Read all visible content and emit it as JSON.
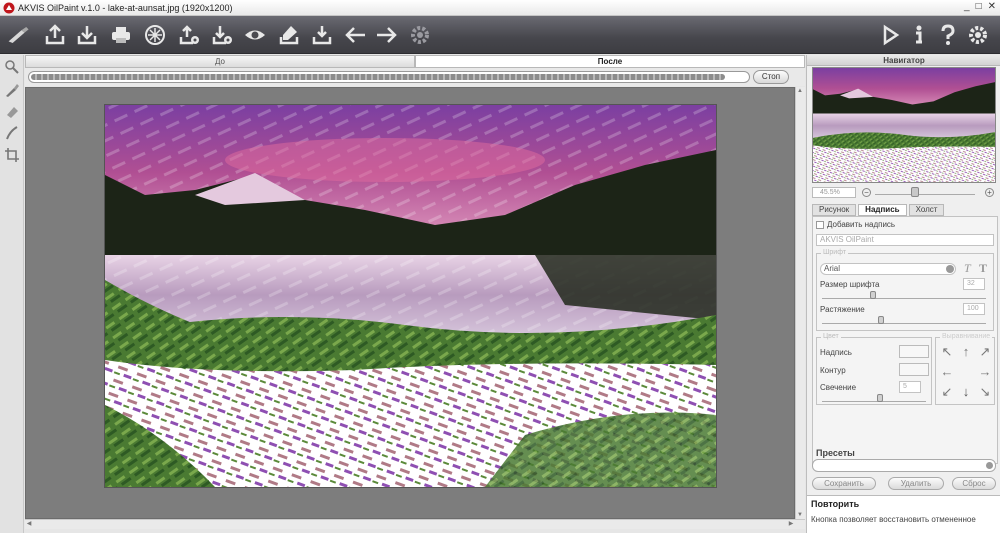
{
  "window": {
    "title": "AKVIS OilPaint v.1.0 - lake-at-aunsat.jpg (1920x1200)",
    "controls": [
      "_",
      "□",
      "✕"
    ]
  },
  "toolbar": {
    "left_icons": [
      "brush-logo-icon",
      "open-icon",
      "save-icon",
      "print-icon",
      "share-icon",
      "upload-settings-icon",
      "download-settings-icon",
      "eye-icon",
      "save-preset-icon",
      "load-preset-icon",
      "undo-icon",
      "redo-icon",
      "gear-settings-icon"
    ],
    "right_icons": [
      "run-icon",
      "info-icon",
      "help-icon",
      "preferences-icon"
    ]
  },
  "left_tools": [
    "zoom-tool-icon",
    "brush-tool-icon",
    "eraser-tool-icon",
    "smudge-tool-icon",
    "crop-tool-icon"
  ],
  "view_tabs": {
    "before": "До",
    "after": "После"
  },
  "progress": {
    "value": 0.97,
    "stop_label": "Стоп"
  },
  "navigator": {
    "title": "Навигатор",
    "zoom": "45.5%"
  },
  "panel_tabs": {
    "tab1": "Рисунок",
    "tab2": "Надпись",
    "tab3": "Холст"
  },
  "text": {
    "add_text_label": "Добавить надпись",
    "text_value": "AKVIS OilPaint",
    "font_group": "Шрифт",
    "font_name": "Arial",
    "font_size_label": "Размер шрифта",
    "font_size": "32",
    "stretch_label": "Растяжение",
    "stretch": "100",
    "color_group": "Цвет",
    "text_color_label": "Надпись",
    "outline_label": "Контур",
    "glow_label": "Свечение",
    "glow": "5",
    "alignment_group": "Выравнивание",
    "align_arrows": [
      "↖",
      "↑",
      "↗",
      "←",
      "→",
      "↙",
      "↓",
      "↘"
    ]
  },
  "presets": {
    "title": "Пресеты",
    "save": "Сохранить",
    "delete": "Удалить",
    "reset": "Сброс"
  },
  "hint": {
    "title": "Повторить",
    "text": "Кнопка позволяет восстановить отмененное"
  },
  "colors": {
    "toolbar": "#4a4a50",
    "canvas_bg": "#7d7d7d",
    "panel_bg": "#efefef"
  }
}
